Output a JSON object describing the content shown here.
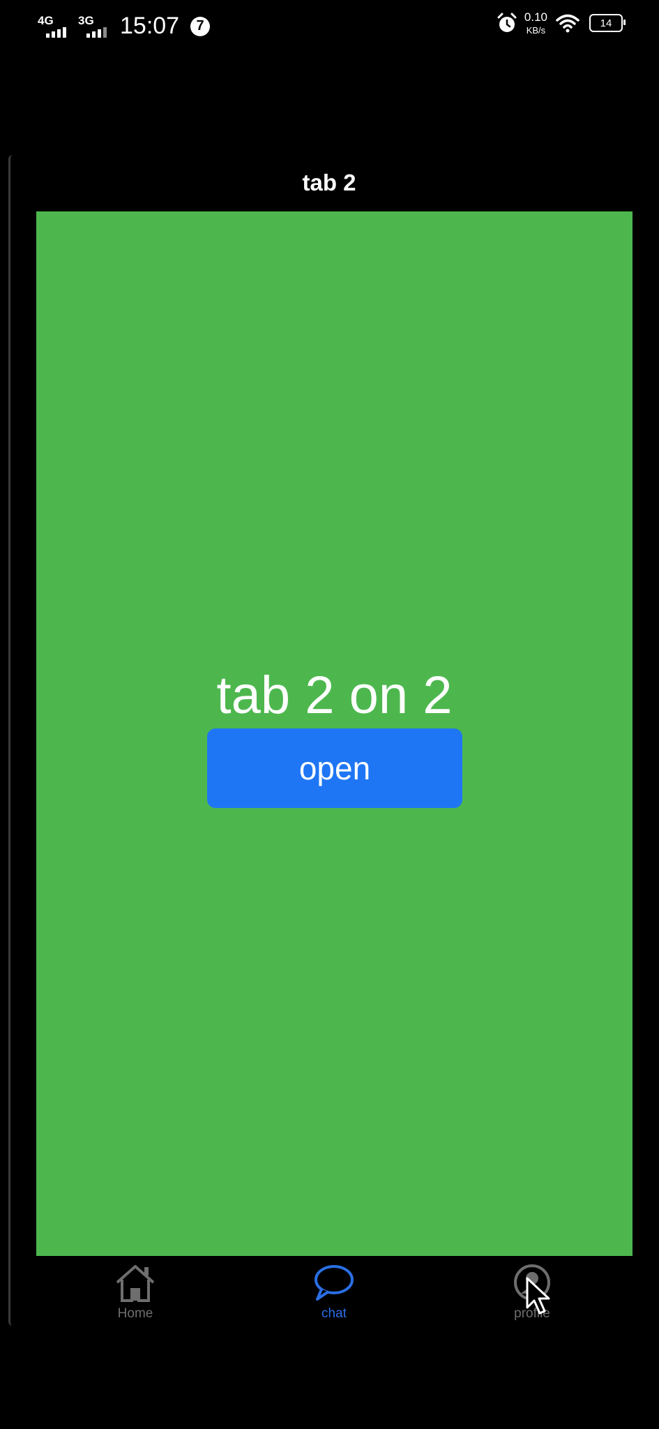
{
  "status_bar": {
    "network_1": "4G",
    "network_2": "3G",
    "time": "15:07",
    "notification_count": "7",
    "net_speed_value": "0.10",
    "net_speed_unit": "KB/s",
    "battery": "14"
  },
  "header": {
    "title": "tab 2"
  },
  "main": {
    "heading": "tab 2 on 2",
    "open_button": "open",
    "background_color": "#4db74e",
    "button_color": "#1f76f4"
  },
  "tabbar": {
    "items": [
      {
        "label": "Home",
        "icon": "home-icon",
        "active": false
      },
      {
        "label": "chat",
        "icon": "chat-bubble-icon",
        "active": true
      },
      {
        "label": "profile",
        "icon": "profile-icon",
        "active": false
      }
    ],
    "active_color": "#2a6fe6",
    "inactive_color": "#6e6e6e"
  },
  "cursor": {
    "icon": "mouse-pointer-icon"
  }
}
